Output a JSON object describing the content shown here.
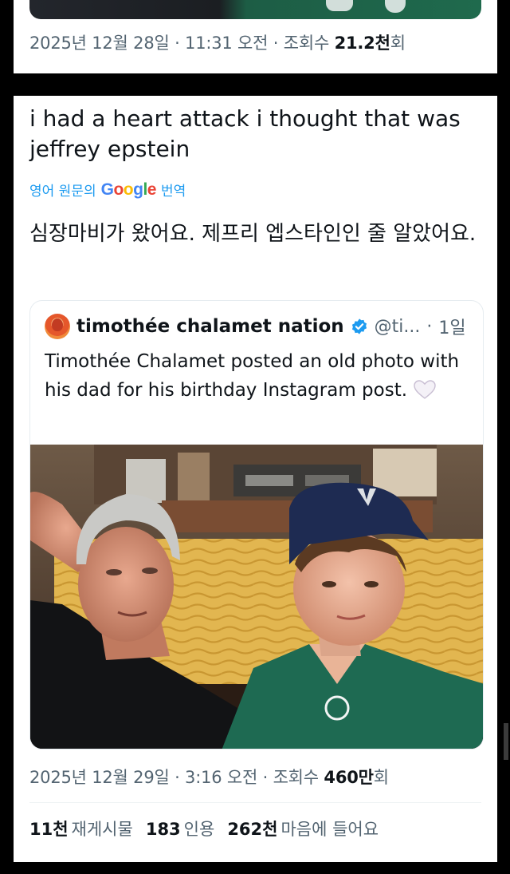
{
  "top_tweet": {
    "meta": {
      "date": "2025년 12월 28일",
      "sep1": " · ",
      "time": "11:31 오전",
      "sep2": " · ",
      "views_label": "조회수 ",
      "views_value": "21.2천",
      "views_suffix": "회"
    }
  },
  "tweet": {
    "text": "i had a heart attack i thought that was jeffrey epstein",
    "translate": {
      "prefix": "영어 원문의",
      "google_logo": [
        "G",
        "o",
        "o",
        "g",
        "l",
        "e"
      ],
      "suffix": "번역"
    },
    "translated_text": "심장마비가 왔어요. 제프리 엡스타인인 줄 알았어요.",
    "quote": {
      "author_name": "timothée chalamet nation",
      "handle": "@ti...",
      "sep": " · ",
      "age": "1일",
      "text": "Timothée Chalamet posted an old photo with his dad for his birthday Instagram post.",
      "emoji": "heart-icon",
      "photo": "photo-father-son"
    },
    "meta": {
      "date": "2025년 12월 29일",
      "sep1": " · ",
      "time": "3:16 오전",
      "sep2": " · ",
      "views_label": "조회수 ",
      "views_value": "460만",
      "views_suffix": "회"
    },
    "stats": {
      "reposts_value": "11천",
      "reposts_label": "재게시물",
      "quotes_value": "183",
      "quotes_label": "인용",
      "likes_value": "262천",
      "likes_label": "마음에 들어요"
    }
  },
  "colors": {
    "text": "#0f1419",
    "muted": "#536471",
    "link": "#1d9bf0",
    "verified": "#1d9bf0",
    "background": "#000000"
  }
}
